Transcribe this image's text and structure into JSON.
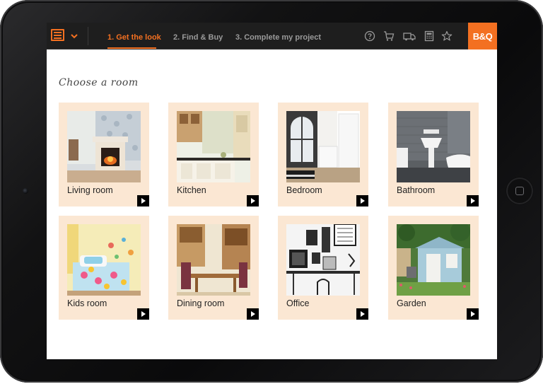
{
  "nav": {
    "tabs": [
      {
        "label": "1. Get the look",
        "active": true
      },
      {
        "label": "2. Find & Buy",
        "active": false
      },
      {
        "label": "3. Complete my project",
        "active": false
      }
    ],
    "icons": [
      "menu-icon",
      "chevron-down-icon",
      "help-icon",
      "cart-icon",
      "delivery-truck-icon",
      "calculator-icon",
      "star-icon"
    ],
    "brand_logo": "B&Q",
    "accent_color": "#f37021"
  },
  "main": {
    "title": "Choose a room",
    "rooms": [
      {
        "label": "Living room"
      },
      {
        "label": "Kitchen"
      },
      {
        "label": "Bedroom"
      },
      {
        "label": "Bathroom"
      },
      {
        "label": "Kids room"
      },
      {
        "label": "Dining room"
      },
      {
        "label": "Office"
      },
      {
        "label": "Garden"
      }
    ]
  }
}
